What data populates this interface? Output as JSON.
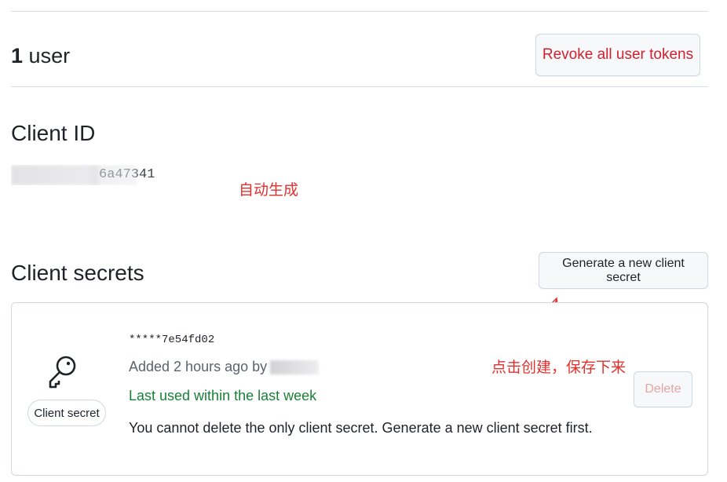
{
  "users": {
    "count": "1",
    "label": "user",
    "revoke_button": "Revoke all user tokens"
  },
  "client_id": {
    "title": "Client ID",
    "value_visible": "6a47341",
    "annotation": "自动生成"
  },
  "client_secrets": {
    "title": "Client secrets",
    "generate_button": "Generate a new client secret",
    "annotation": "点击创建，保存下来",
    "secret": {
      "badge_label": "Client secret",
      "masked_value": "*****7e54fd02",
      "added_text": "Added 2 hours ago by",
      "last_used": "Last used within the last week",
      "warning": "You cannot delete the only client secret. Generate a new client secret first.",
      "delete_button": "Delete"
    }
  },
  "colors": {
    "danger": "#cf222e",
    "success": "#1a7f37",
    "annotation": "#e0312f",
    "border": "#d0d7de"
  },
  "icons": {
    "secret_icon": "key-icon",
    "annotation_arrow": "arrow-icon"
  }
}
